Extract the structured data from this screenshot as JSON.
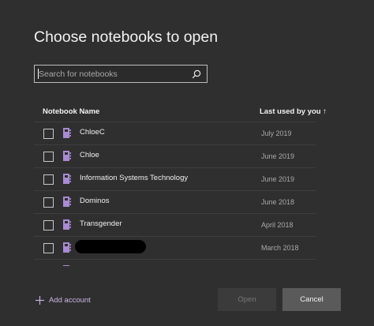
{
  "dialog": {
    "title": "Choose notebooks to open"
  },
  "search": {
    "placeholder": "Search for notebooks",
    "value": ""
  },
  "columns": {
    "name_label": "Notebook Name",
    "date_label": "Last used by you ↑"
  },
  "notebooks": [
    {
      "name": "ChloeC",
      "date": "July 2019",
      "checked": false
    },
    {
      "name": "Chloe",
      "date": "June 2019",
      "checked": false
    },
    {
      "name": "Information Systems Technology",
      "date": "June 2019",
      "checked": false
    },
    {
      "name": "Dominos",
      "date": "June 2018",
      "checked": false
    },
    {
      "name": "Transgender",
      "date": "April 2018",
      "checked": false
    },
    {
      "name": "",
      "date": "March 2018",
      "checked": false,
      "redacted": true
    },
    {
      "name": "",
      "date": "",
      "checked": false
    }
  ],
  "footer": {
    "add_account_label": "Add account",
    "open_label": "Open",
    "cancel_label": "Cancel"
  },
  "colors": {
    "background": "#302f2f",
    "notebook_icon": "#a98ad4",
    "accent_link": "#c9b6e6",
    "cancel_button": "#5b5a5a",
    "open_button_disabled": "#3c3b3b"
  },
  "icons": {
    "search": "search-icon",
    "notebook": "notebook-icon",
    "add": "plus-icon"
  }
}
